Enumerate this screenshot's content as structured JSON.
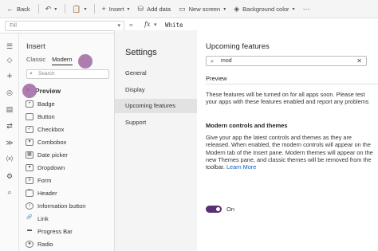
{
  "toolbar": {
    "back": "Back",
    "insert": "Insert",
    "add_data": "Add data",
    "new_screen": "New screen",
    "background_color": "Background color"
  },
  "formula_bar": {
    "property": "Fill",
    "eq": "=",
    "fx": "fx",
    "value": "White"
  },
  "insert_pane": {
    "title": "Insert",
    "tabs": [
      "Classic",
      "Modern"
    ],
    "search_placeholder": "Search",
    "group": "Preview",
    "items": [
      "Badge",
      "Button",
      "Checkbox",
      "Combobox",
      "Date picker",
      "Dropdown",
      "Form",
      "Header",
      "Information button",
      "Link",
      "Progress Bar",
      "Radio"
    ]
  },
  "settings": {
    "title": "Settings",
    "nav": [
      "General",
      "Display",
      "Upcoming features",
      "Support"
    ],
    "active_nav": "Upcoming features",
    "content": {
      "title": "Upcoming features",
      "search_value": "mod",
      "tab": "Preview",
      "intro": "These features will be turned on for all apps soon. Please test your apps with these features enabled and report any problems",
      "section_title": "Modern controls and themes",
      "section_text": "Give your app the latest controls and themes as they are released. When enabled, the modern controls will appear on the Modern tab of the Insert pane. Modern themes will appear on the new Themes pane, and classic themes will be removed from the toolbar.",
      "learn_more": "Learn More",
      "toggle_label": "On",
      "toggle_on": true
    }
  },
  "colors": {
    "accent": "#5b2f76",
    "marker": "#a46fa7",
    "link": "#1060c0"
  }
}
